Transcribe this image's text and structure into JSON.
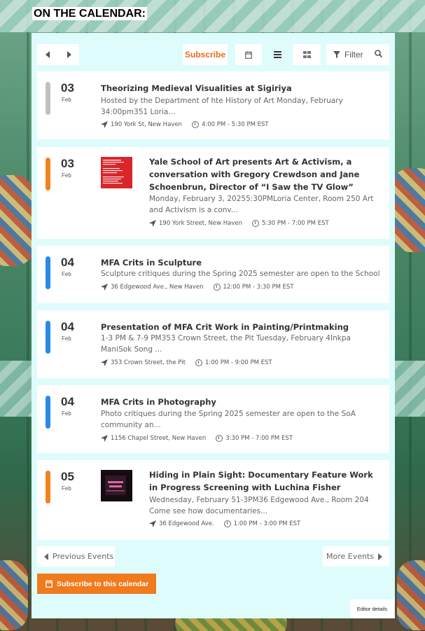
{
  "heading": "ON THE CALENDAR:",
  "toolbar": {
    "subscribe_label": "Subscribe",
    "filter_label": "Filter"
  },
  "colors": {
    "accent": "#e86b1f",
    "panel_bg": "#dffcfd",
    "bar_gray": "#c0c0c0",
    "bar_orange": "#f0831e",
    "bar_blue": "#2a8be6"
  },
  "events": [
    {
      "day": "03",
      "month": "Feb",
      "title": "Theorizing Medieval Visualities at Sigiriya",
      "desc": "Hosted by the Department of hte History of Art Monday, February 34:00pm351 Loria...",
      "location": "190 York St, New Haven",
      "time": "4:00 PM - 5:30 PM EST",
      "bar_color": "gray",
      "has_thumb": false
    },
    {
      "day": "03",
      "month": "Feb",
      "title": "Yale School of Art presents Art & Activism, a conversation with Gregory Crewdson and Jane Schoenbrun, Director of “I Saw the TV Glow”",
      "desc": "Monday, February 3, 20255:30PMLoria Center, Room 250 Art and Activism is a conv...",
      "location": "190 York Street, New Haven",
      "time": "5:30 PM - 7:00 PM EST",
      "bar_color": "orange",
      "has_thumb": true
    },
    {
      "day": "04",
      "month": "Feb",
      "title": "MFA Crits in Sculpture",
      "desc": "Sculpture critiques during the Spring 2025 semester are open to the School of Ar...",
      "location": "36 Edgewood Ave., New Haven",
      "time": "12:00 PM - 3:30 PM EST",
      "bar_color": "blue",
      "has_thumb": false
    },
    {
      "day": "04",
      "month": "Feb",
      "title": "Presentation of MFA Crit Work in Painting/Printmaking",
      "desc": "1-3 PM & 7-9 PM353 Crown Street, the Pit Tuesday, February 4Inkpa ManiSok Song ...",
      "location": "353 Crown Street, the Pit",
      "time": "1:00 PM - 9:00 PM EST",
      "bar_color": "blue",
      "has_thumb": false
    },
    {
      "day": "04",
      "month": "Feb",
      "title": "MFA Crits in Photography",
      "desc": "Photo critiques during the Spring 2025 semester are open to the SoA community an...",
      "location": "1156 Chapel Street, New Haven",
      "time": "3:30 PM - 7:00 PM EST",
      "bar_color": "blue",
      "has_thumb": false
    },
    {
      "day": "05",
      "month": "Feb",
      "title": "Hiding in Plain Sight: Documentary Feature Work in Progress Screening with Luchina Fisher",
      "desc": "Wednesday, February 51-3PM36 Edgewood Ave., Room 204 Come see how documentaries...",
      "location": "36 Edgewood Ave.",
      "time": "1:00 PM - 3:00 PM EST",
      "bar_color": "orange",
      "has_thumb": true
    }
  ],
  "pager": {
    "prev_label": "Previous Events",
    "more_label": "More Events"
  },
  "subscribe_calendar_label": "Subscribe to this calendar",
  "editor_label": "Editor details",
  "icons": {
    "prev": "chevron-left-icon",
    "next": "chevron-right-icon",
    "calendar": "calendar-icon",
    "list": "list-icon",
    "grid": "grid-icon",
    "filter": "filter-icon",
    "search": "search-icon",
    "location": "location-arrow-icon",
    "clock": "clock-icon"
  }
}
